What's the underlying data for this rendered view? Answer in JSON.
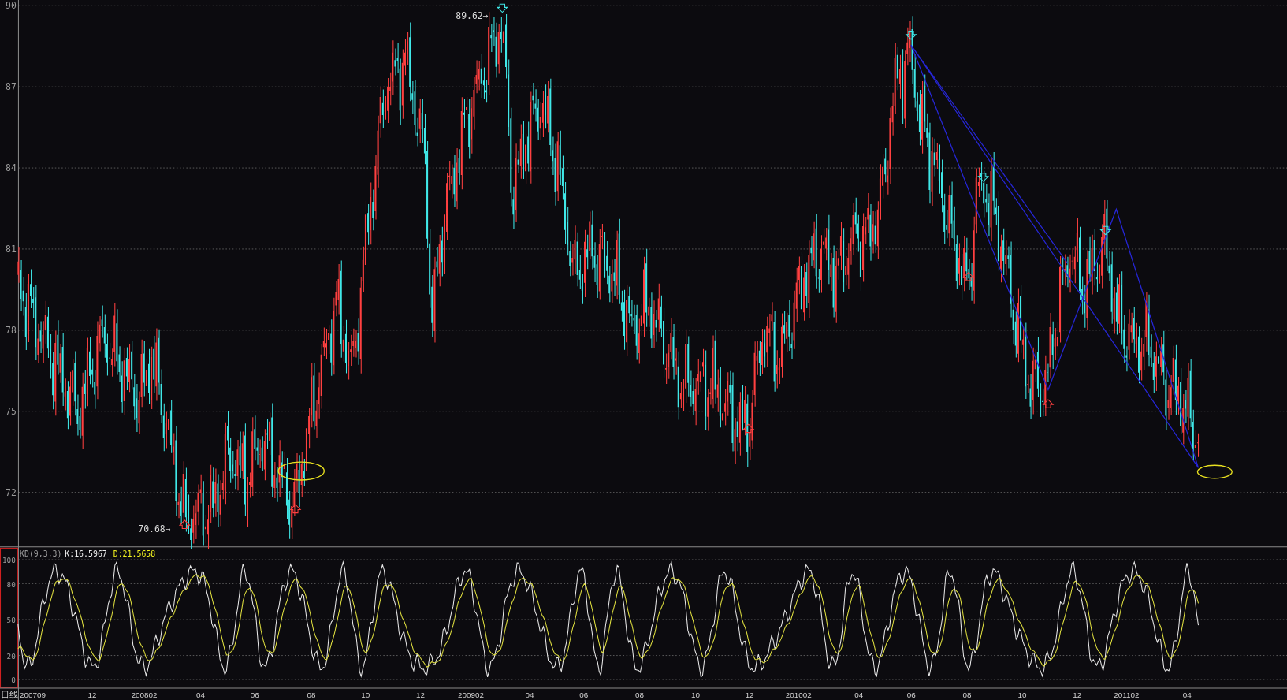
{
  "price_axis": {
    "ticks": [
      "90",
      "87",
      "84",
      "81",
      "78",
      "75",
      "72"
    ]
  },
  "price_labels": [
    {
      "kind": "high",
      "text": "89.62→"
    },
    {
      "kind": "low",
      "text": "70.68→"
    }
  ],
  "indicator": {
    "name": "KD(9,3,3)",
    "k": "K:16.5967",
    "d": "D:21.5658",
    "ticks": [
      "100",
      "80",
      "50",
      "20",
      "0"
    ]
  },
  "date_axis": {
    "period": "日线",
    "labels": [
      "200709",
      "12",
      "200802",
      "04",
      "06",
      "08",
      "10",
      "12",
      "200902",
      "04",
      "06",
      "08",
      "10",
      "12",
      "201002",
      "04",
      "06",
      "08",
      "10",
      "12",
      "201102",
      "04"
    ]
  }
}
